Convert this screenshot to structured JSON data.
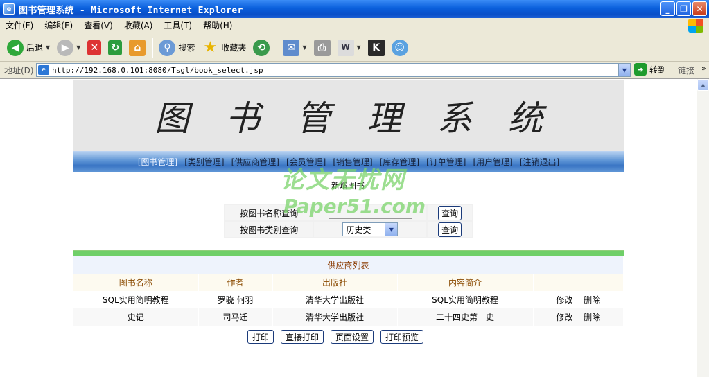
{
  "window": {
    "title": "图书管理系统 - Microsoft Internet Explorer",
    "app_icon_glyph": "e"
  },
  "menu": [
    "文件(F)",
    "编辑(E)",
    "查看(V)",
    "收藏(A)",
    "工具(T)",
    "帮助(H)"
  ],
  "toolbar": {
    "back": "后退",
    "search": "搜索",
    "favorites": "收藏夹"
  },
  "address": {
    "label": "地址(D)",
    "url": "http://192.168.0.101:8080/Tsgl/book_select.jsp",
    "go": "转到",
    "links": "链接"
  },
  "page": {
    "banner_title": "图书管理系统",
    "nav": [
      "[图书管理]",
      "[类别管理]",
      "[供应商管理]",
      "[会员管理]",
      "[销售管理]",
      "[库存管理]",
      "[订单管理]",
      "[用户管理]",
      "[注销退出]"
    ],
    "nav_active_index": 0,
    "new_book": "新增图书",
    "search": {
      "by_name_label": "按图书名称查询",
      "by_name_value": "",
      "by_category_label": "按图书类别查询",
      "category_selected": "历史类",
      "query_button": "查询"
    },
    "watermark": {
      "line1": "论文无忧网",
      "line2": "Paper51.com"
    },
    "list": {
      "caption": "供应商列表",
      "headers": [
        "图书名称",
        "作者",
        "出版社",
        "内容简介",
        ""
      ],
      "rows": [
        {
          "name": "SQL实用简明教程",
          "author": "罗骁 何羽",
          "publisher": "清华大学出版社",
          "summary": "SQL实用简明教程",
          "edit": "修改",
          "delete": "删除"
        },
        {
          "name": "史记",
          "author": "司马迁",
          "publisher": "清华大学出版社",
          "summary": "二十四史第一史",
          "edit": "修改",
          "delete": "删除"
        }
      ]
    },
    "print_buttons": [
      "打印",
      "直接打印",
      "页面设置",
      "打印预览"
    ]
  },
  "colors": {
    "nav_bar": "#3a75c4",
    "list_top": "#6fcf68",
    "header_text": "#8a4a00"
  }
}
